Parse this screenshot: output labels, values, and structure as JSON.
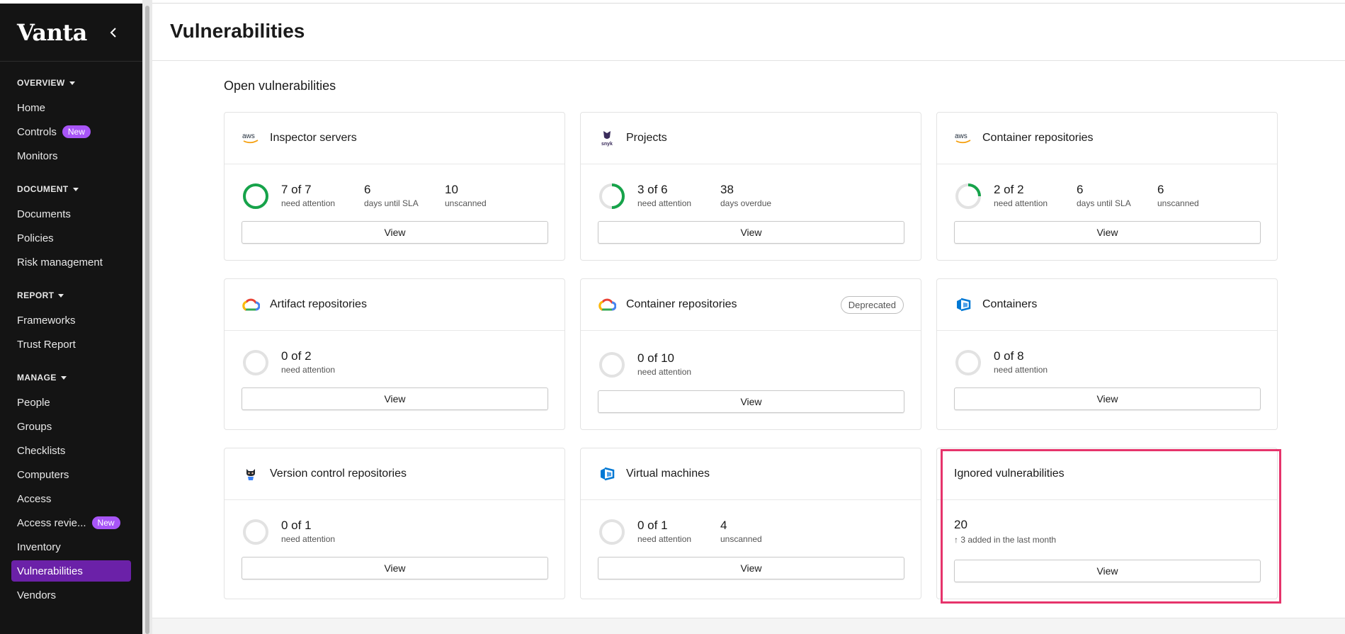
{
  "sidebar": {
    "brand": "Vanta",
    "sections": {
      "overview": "OVERVIEW",
      "document": "DOCUMENT",
      "report": "REPORT",
      "manage": "MANAGE"
    },
    "items": {
      "home": "Home",
      "controls": "Controls",
      "controls_badge": "New",
      "monitors": "Monitors",
      "documents": "Documents",
      "policies": "Policies",
      "risk": "Risk management",
      "frameworks": "Frameworks",
      "trust_report": "Trust Report",
      "people": "People",
      "groups": "Groups",
      "checklists": "Checklists",
      "computers": "Computers",
      "access": "Access",
      "access_reviews": "Access revie...",
      "access_reviews_badge": "New",
      "inventory": "Inventory",
      "vulnerabilities": "Vulnerabilities",
      "vendors": "Vendors"
    },
    "active_color": "#6b21a8"
  },
  "header": {
    "title": "Vulnerabilities"
  },
  "main": {
    "section_title": "Open vulnerabilities",
    "cards": [
      {
        "title": "Inspector servers",
        "logo": "aws-logo",
        "attention_value": "7 of 7",
        "attention_label": "need attention",
        "attention_fraction": 1.0,
        "stat2_value": "6",
        "stat2_label": "days until SLA",
        "stat3_value": "10",
        "stat3_label": "unscanned",
        "button": "View"
      },
      {
        "title": "Projects",
        "logo": "snyk-logo",
        "attention_value": "3 of 6",
        "attention_label": "need attention",
        "attention_fraction": 0.5,
        "stat2_value": "38",
        "stat2_label": "days overdue",
        "button": "View"
      },
      {
        "title": "Container repositories",
        "logo": "aws-logo",
        "attention_value": "2 of 2",
        "attention_label": "need attention",
        "attention_fraction": 0.25,
        "stat2_value": "6",
        "stat2_label": "days until SLA",
        "stat3_value": "6",
        "stat3_label": "unscanned",
        "button": "View"
      },
      {
        "title": "Artifact repositories",
        "logo": "gcp-logo",
        "attention_value": "0 of 2",
        "attention_label": "need attention",
        "attention_fraction": 0,
        "button": "View"
      },
      {
        "title": "Container repositories",
        "logo": "gcp-logo",
        "badge": "Deprecated",
        "attention_value": "0 of 10",
        "attention_label": "need attention",
        "attention_fraction": 0,
        "button": "View"
      },
      {
        "title": "Containers",
        "logo": "azure-logo",
        "attention_value": "0 of 8",
        "attention_label": "need attention",
        "attention_fraction": 0,
        "button": "View"
      },
      {
        "title": "Version control repositories",
        "logo": "github-logo",
        "attention_value": "0 of 1",
        "attention_label": "need attention",
        "attention_fraction": 0,
        "button": "View"
      },
      {
        "title": "Virtual machines",
        "logo": "azure-logo",
        "attention_value": "0 of 1",
        "attention_label": "need attention",
        "attention_fraction": 0,
        "stat2_value": "4",
        "stat2_label": "unscanned",
        "button": "View"
      },
      {
        "title": "Ignored vulnerabilities",
        "count": "20",
        "arrow": "↑",
        "subtext": "3 added in the last month",
        "button": "View"
      }
    ],
    "colors": {
      "ring_green": "#16a34a",
      "ring_gray": "#e2e2e2",
      "highlight": "#e6336b"
    }
  }
}
